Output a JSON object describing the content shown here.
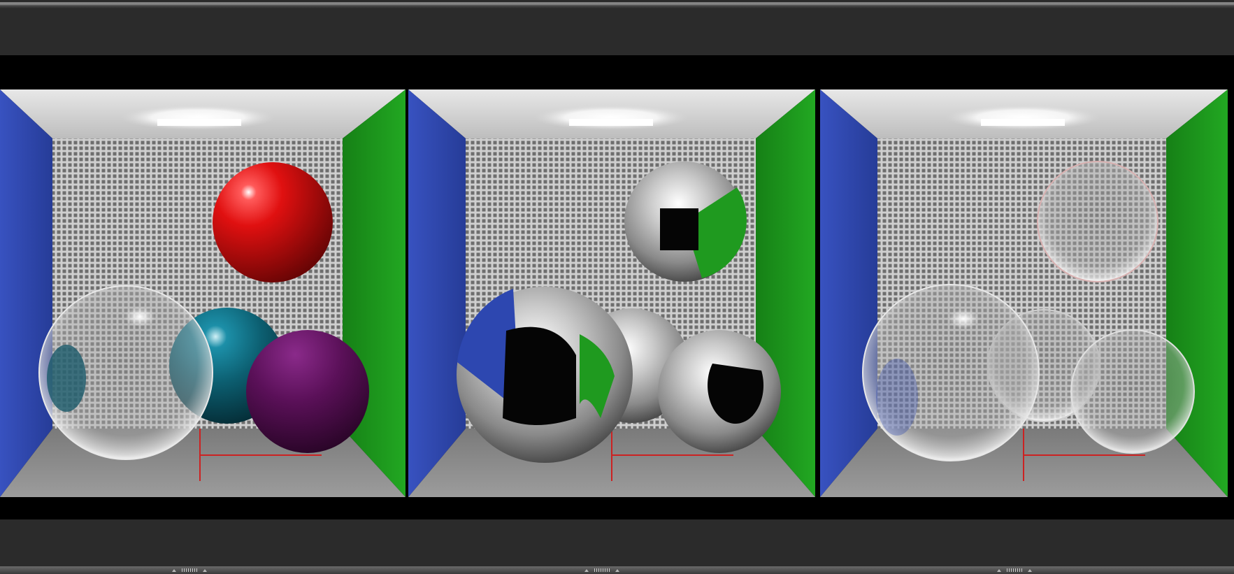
{
  "app": {
    "toolbar_background": "#2b2b2b",
    "canvas_background": "#000000"
  },
  "viewports": [
    {
      "material": "diffuse-colored",
      "spheres": [
        "red",
        "teal",
        "glass",
        "purple"
      ]
    },
    {
      "material": "mirror",
      "spheres": [
        "chrome",
        "chrome",
        "chrome",
        "chrome"
      ]
    },
    {
      "material": "glass",
      "spheres": [
        "glass",
        "glass",
        "glass",
        "glass"
      ]
    }
  ],
  "colors": {
    "left_wall": "#2d47b0",
    "right_wall": "#1f9a1f",
    "back_wall": "#a8a8a8",
    "floor": "#8e8e8e",
    "axis": "#cc2222",
    "red_sphere": "#d81010",
    "teal_sphere": "#0e6072",
    "purple_sphere": "#5a1058"
  },
  "splitter_handles": [
    {
      "icon": "grip-icon"
    },
    {
      "icon": "grip-icon"
    },
    {
      "icon": "grip-icon"
    }
  ]
}
